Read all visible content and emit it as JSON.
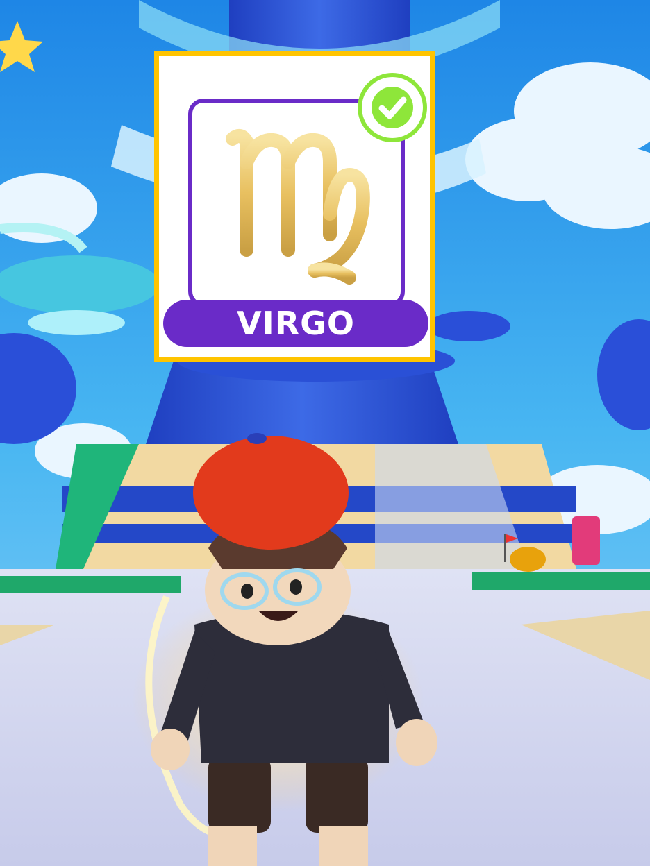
{
  "zodiac_card": {
    "name": "VIRGO",
    "sign_icon": "virgo-symbol-icon",
    "selected": true,
    "status_icon": "checkmark-icon"
  },
  "colors": {
    "card_border": "#ffc400",
    "banner": "#6a2bc8",
    "check": "#8ee63a",
    "sign_gold": "#e8c060"
  }
}
